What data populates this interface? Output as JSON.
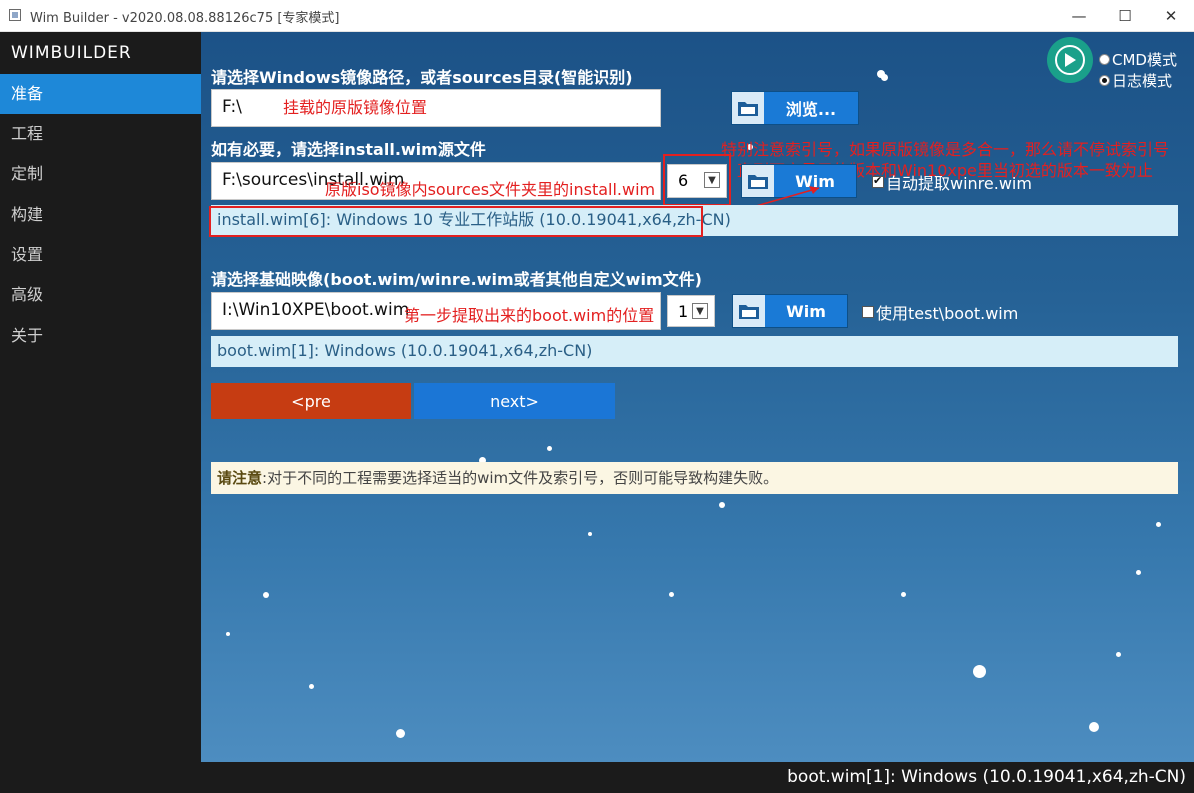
{
  "window": {
    "title": "Wim Builder - v2020.08.08.88126c75 [专家模式]",
    "minimize": "—",
    "maximize": "☐",
    "close": "✕"
  },
  "sidebar": {
    "brand": "WIMBUILDER",
    "items": [
      {
        "label": "准备",
        "active": true
      },
      {
        "label": "工程",
        "active": false
      },
      {
        "label": "定制",
        "active": false
      },
      {
        "label": "构建",
        "active": false
      },
      {
        "label": "设置",
        "active": false
      },
      {
        "label": "高级",
        "active": false
      },
      {
        "label": "关于",
        "active": false
      }
    ]
  },
  "mode": {
    "options": [
      {
        "label": "CMD模式",
        "selected": false
      },
      {
        "label": "日志模式",
        "selected": true
      }
    ]
  },
  "source": {
    "label": "请选择Windows镜像路径，或者sources目录(智能识别)",
    "value": "F:\\",
    "annotation": "挂载的原版镜像位置",
    "browse_label": "浏览..."
  },
  "install_wim": {
    "label": "如有必要，请选择install.wim源文件",
    "value": "F:\\sources\\install.wim",
    "annotation": "原版iso镜像内sources文件夹里的install.wim",
    "index": "6",
    "wim_button": "Wim",
    "auto_extract_label": "自动提取winre.wim",
    "auto_extract_checked": true,
    "info": "install.wim[6]: Windows 10 专业工作站版 (10.0.19041,x64,zh-CN)",
    "tip_line1": "特别注意索引号，如果原版镜像是多合一，那么请不停试索引号",
    "tip_line2": "直到下方显示的版本和Win10xpe里当初选的版本一致为止"
  },
  "boot_wim": {
    "label": "请选择基础映像(boot.wim/winre.wim或者其他自定义wim文件)",
    "value": "I:\\Win10XPE\\boot.wim",
    "annotation": "第一步提取出来的boot.wim的位置",
    "index": "1",
    "wim_button": "Wim",
    "test_label": "使用test\\boot.wim",
    "test_checked": false,
    "info": "boot.wim[1]: Windows (10.0.19041,x64,zh-CN)"
  },
  "navigation": {
    "pre_label": "<pre",
    "next_label": "next>"
  },
  "notice": {
    "bold": "请注意",
    "text": ":对于不同的工程需要选择适当的wim文件及索引号，否则可能导致构建失败。"
  },
  "status": {
    "text": "boot.wim[1]: Windows (10.0.19041,x64,zh-CN)"
  },
  "colors": {
    "accent": "#1e88d8",
    "pre_button": "#c63c12",
    "annotation": "#e32020",
    "sidebar_bg": "#1b1b1b"
  }
}
